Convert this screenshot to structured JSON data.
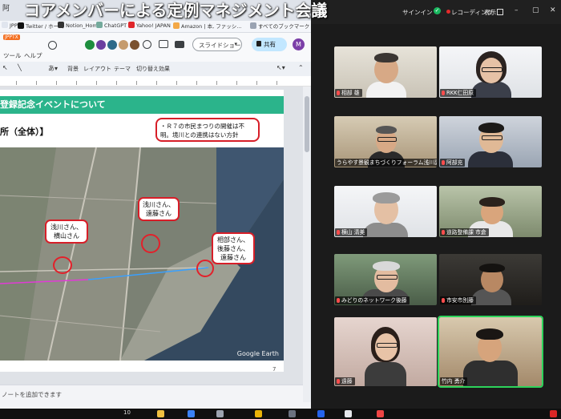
{
  "overlay_title": "コアメンバーによる定例マネジメント会議",
  "browser": {
    "tab_badge": "阿",
    "bookmarks": [
      {
        "icon": "jpptx-icon",
        "label": "JPPTX",
        "color": "#e0e5ee"
      },
      {
        "icon": "x-icon",
        "label": "Twitter / ホーム",
        "color": "#111111"
      },
      {
        "icon": "notion-icon",
        "label": "Notion_Home",
        "color": "#333333"
      },
      {
        "icon": "chatgpt-icon",
        "label": "ChatGPT",
        "color": "#74aa9c"
      },
      {
        "icon": "yahoo-icon",
        "label": "Yahoo! JAPAN",
        "color": "#e0262a"
      },
      {
        "icon": "amazon-icon",
        "label": "Amazon | 本, ファッシ…",
        "color": "#f3a847"
      }
    ],
    "all_bookmarks": "すべてのブックマーク",
    "app_badge": "JPPTX",
    "menu": [
      "ツール",
      "ヘルプ"
    ],
    "slideshow_button": "スライドショー",
    "share_button": "共有",
    "account_initial": "M",
    "toolbar_items": [
      "背景",
      "レイアウト",
      "テーマ",
      "切り替え効果"
    ],
    "notes_placeholder": "ノートを追加できます"
  },
  "slide": {
    "title": "登録記念イベントについて",
    "subtitle": "所（全体）】",
    "callout_top": "・Ｒ７の市民まつりの開催は不明。境川との連携はない方針",
    "bubbles": [
      {
        "text": "浅川さん、横山さん"
      },
      {
        "text": "浅川さん、遠藤さん"
      },
      {
        "text": "相部さん、後藤さん、遠藤さん"
      }
    ],
    "attribution": "Google Earth",
    "page_number": "7"
  },
  "meeting": {
    "sign_in": "サインイン",
    "recording": "レコーディング",
    "view": "表示",
    "participants": [
      {
        "name": "相部 雄"
      },
      {
        "name": "RKK仁田原"
      },
      {
        "name": "うらやす景観まちづくりフォーラム浅川副"
      },
      {
        "name": "阿部充"
      },
      {
        "name": "横山 清美"
      },
      {
        "name": "道路整備課 市倉"
      },
      {
        "name": "みどりのネットワーク後藤"
      },
      {
        "name": "市安市別藤"
      },
      {
        "name": "遠藤"
      },
      {
        "name": "竹内 勇介"
      }
    ]
  },
  "taskbar": {
    "notification_count": "10"
  }
}
